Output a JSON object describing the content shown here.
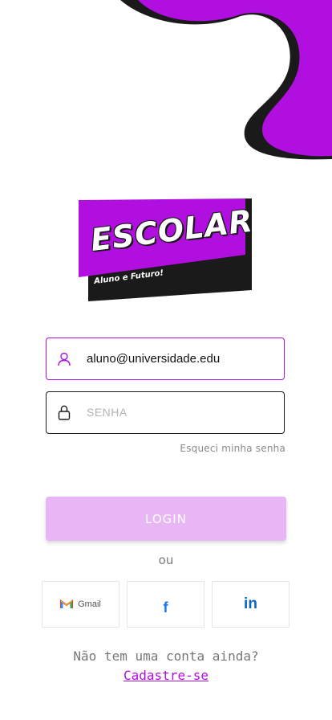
{
  "colors": {
    "brand": "#b10ee0",
    "brand_light": "#e8b6f5",
    "dark": "#1a1a1a"
  },
  "logo": {
    "title": "ESCOLAR",
    "tagline": "Aluno e Futuro!"
  },
  "form": {
    "email": {
      "value": "aluno@universidade.edu",
      "icon": "user-icon"
    },
    "password": {
      "placeholder": "SENHA",
      "icon": "lock-icon"
    },
    "forgot_label": "Esqueci minha senha",
    "login_label": "LOGIN"
  },
  "social": {
    "separator": "ou",
    "gmail_label": "Gmail",
    "facebook_glyph": "f",
    "linkedin_glyph": "in"
  },
  "footer": {
    "no_account": "Não tem uma conta ainda?",
    "signup_label": "Cadastre-se"
  }
}
